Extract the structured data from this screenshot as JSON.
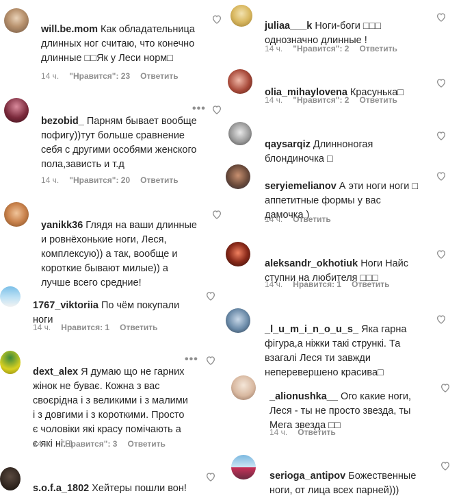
{
  "left": [
    {
      "user": "will.be.mom",
      "text": "Как обладательница длинных ног считаю, что конечно длинные □□Як у Леси норм□",
      "time": "14 ч.",
      "likes": "\"Нравится\": 23",
      "reply": "Ответить"
    },
    {
      "user": "bezobid_",
      "text": "Парням бывает вообще пофигу))тут больше сравнение себя с другими особями женского пола,зависть и т.д",
      "time": "14 ч.",
      "likes": "\"Нравится\": 20",
      "reply": "Ответить"
    },
    {
      "user": "yanikk36",
      "text": "Глядя на ваши длинные и ровнёхонькие ноги, Леся, комплексую)) а так, вообще и короткие бывают милые)) а лучше всего средние!",
      "time": "",
      "likes": "",
      "reply": ""
    },
    {
      "user": "1767_viktoriia",
      "text": "По чём покупали ноги",
      "time": "14 ч.",
      "likes": "Нравится: 1",
      "reply": "Ответить"
    },
    {
      "user": "dext_alex",
      "text": "Я думаю що не гарних жінок не буває. Кожна з вас своєрідна і з великими і з малими і з довгими і з короткими. Просто є чоловіки які красу помічають а є які ні.□",
      "time": "14 ч.",
      "likes": "\"Нравится\": 3",
      "reply": "Ответить"
    },
    {
      "user": "s.o.f.a_1802",
      "text": "Хейтеры пошли вон!",
      "time": "",
      "likes": "",
      "reply": ""
    }
  ],
  "right": [
    {
      "user": "juliaa___k",
      "text": "Ноги-боги □□□ однозначно длинные !",
      "time": "14 ч.",
      "likes": "\"Нравится\": 2",
      "reply": "Ответить"
    },
    {
      "user": "olia_mihaylovena",
      "text": "Красунька□",
      "time": "14 ч.",
      "likes": "\"Нравится\": 2",
      "reply": "Ответить"
    },
    {
      "user": "qaysarqiz",
      "text": "Длинноногая блондиночка □",
      "time": "",
      "likes": "",
      "reply": ""
    },
    {
      "user": "seryiemelianov",
      "text": "А эти ноги ноги □ аппетитные формы у вас дамочка )",
      "time": "14 ч.",
      "likes": "",
      "reply": "Ответить"
    },
    {
      "user": "aleksandr_okhotiuk",
      "text": "Ноги Найс ступни на любителя □□□",
      "time": "14 ч.",
      "likes": "Нравится: 1",
      "reply": "Ответить"
    },
    {
      "user": "_l_u_m_i_n_o_u_s_",
      "text": "Яка гарна фігура,а ніжки такі стрункі. Та взагалі Леся ти завжди неперевершено красива□",
      "time": "",
      "likes": "",
      "reply": ""
    },
    {
      "user": "_alionushka__",
      "text": "Ого какие ноги, Леся - ты не просто звезда, ты Мега звезда □□",
      "time": "14 ч.",
      "likes": "",
      "reply": "Ответить"
    },
    {
      "user": "serioga_antipov",
      "text": "Божественные ноги, от лица всех парней)))",
      "time": "",
      "likes": "",
      "reply": ""
    }
  ],
  "icons": {
    "heart": "heart-icon",
    "more": "more-options-icon"
  },
  "colors": {
    "text": "#262626",
    "meta": "#8e8e8e",
    "background": "#ffffff"
  }
}
